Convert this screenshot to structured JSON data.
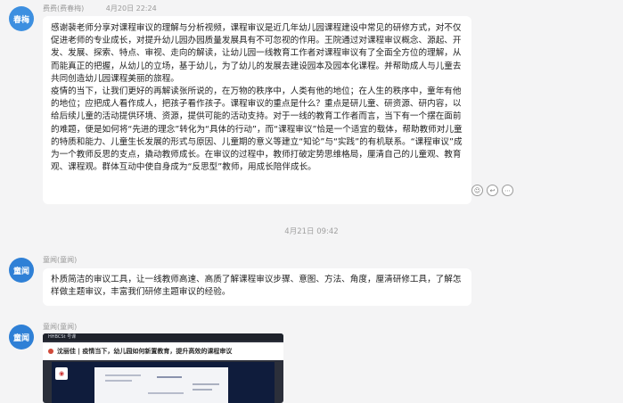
{
  "messages": [
    {
      "avatar": "春梅",
      "sender": "费费(费春梅)",
      "time": "4月20日 22:24",
      "paragraphs": [
        "感谢裴老师分享对课程审议的理解与分析视频，课程审议是近几年幼儿园课程建设中常见的研修方式，对不仅促进老师的专业成长，对提升幼儿园办园质量发展具有不可忽视的作用。王院通过对课程审议概念、源起、开发、发展、探索、特点、审视、走向的解读，让幼儿园一线教育工作者对课程审议有了全面全方位的理解，从而能真正的把握，从幼儿的立场，基于幼儿，为了幼儿的发展去建设园本及园本化课程。并帮助成人与儿童去共同创造幼儿园课程美丽的旅程。",
        "疫情的当下，让我们更好的再解读张所说的，在万物的秩序中，人类有他的地位；在人生的秩序中，童年有他的地位；应把成人看作成人，把孩子看作孩子。课程审议的重点是什么？重点是研儿童、研资源、研内容，以给后续儿童的活动提供环境、资源，提供可能的活动支持。对于一线的教育工作者而言，当下有一个摆在面前的难题，便是如何将“先进的理念”转化为“具体的行动”，而“课程审议”恰是一个适宜的载体，帮助教师对儿童的特质和能力、儿童生长发展的形式与原因、儿童期的意义等建立“知论”与“实践”的有机联系。“课程审议”成为一个教师反思的支点，撬动教师成长。在审议的过程中，教师打破定势思维格局，厘清自己的儿童观、教育观、课程观。群体互动中使自身成为“反思型”教师，用成长陪伴成长。"
      ],
      "reactions": [
        "emoji-icon",
        "reply-icon",
        "more-icon"
      ]
    },
    {
      "divider_time": "4月21日 09:42"
    },
    {
      "avatar": "童闻",
      "sender": "童闻(童闻)",
      "text": "朴质简洁的审议工具，让一线教师高速、高质了解课程审议步骤、意图、方法、角度，厘清研修工具，了解怎样做主题审议，丰富我们研修主题审议的经验。"
    },
    {
      "avatar": "童闻",
      "sender": "童闻(童闻)",
      "shot": {
        "bar": "HHBCSt 号课",
        "banner": "沈丽佳 | 疫情当下，幼儿园如何新置教育，提升高效的课程审议"
      }
    }
  ]
}
